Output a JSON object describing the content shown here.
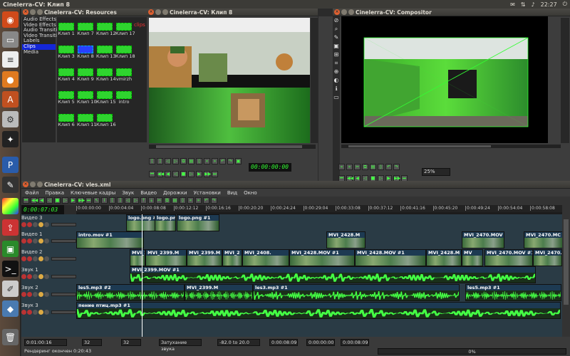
{
  "topbar": {
    "title": "Cinelerra-CV: Клип 8",
    "time": "22:27"
  },
  "resources": {
    "title": "Cinelerra-CV: Resources",
    "tree": [
      "Audio Effects",
      "Video Effects",
      "Audio Transiti",
      "Video Transiti",
      "Labels",
      "Clips",
      "Media"
    ],
    "selected_index": 5,
    "clips": [
      {
        "label": "Клип 1",
        "col": 0,
        "row": 0
      },
      {
        "label": "Клип 7",
        "col": 1,
        "row": 0
      },
      {
        "label": "Клип 12",
        "col": 2,
        "row": 0
      },
      {
        "label": "Клип 17",
        "col": 3,
        "row": 0
      },
      {
        "label": "Клип 3",
        "col": 0,
        "row": 1
      },
      {
        "label": "Клип 8",
        "col": 1,
        "row": 1
      },
      {
        "label": "Клип 13",
        "col": 2,
        "row": 1
      },
      {
        "label": "Клип 18",
        "col": 3,
        "row": 1
      },
      {
        "label": "Клип 4",
        "col": 0,
        "row": 2
      },
      {
        "label": "Клип 9",
        "col": 1,
        "row": 2
      },
      {
        "label": "Клип 14",
        "col": 2,
        "row": 2
      },
      {
        "label": "vmirzh",
        "col": 3,
        "row": 2
      },
      {
        "label": "Клип 5",
        "col": 0,
        "row": 3
      },
      {
        "label": "Клип 10",
        "col": 1,
        "row": 3
      },
      {
        "label": "Клип 15",
        "col": 2,
        "row": 3
      },
      {
        "label": "intro",
        "col": 3,
        "row": 3
      },
      {
        "label": "Клип 6",
        "col": 0,
        "row": 4
      },
      {
        "label": "Клип 11",
        "col": 1,
        "row": 4
      },
      {
        "label": "Клип 16",
        "col": 2,
        "row": 4
      }
    ],
    "selected_clip": "Клип 8",
    "overlay": "clips"
  },
  "viewer": {
    "title": "Cinelerra-CV: Клип 8",
    "timecode": "00:00:00:00"
  },
  "compositor": {
    "title": "Cinelerra-CV: Compositor",
    "zoom": "25%"
  },
  "main": {
    "title": "Cinelerra-CV: vles.xml",
    "menu": [
      "Файл",
      "Правка",
      "Ключевые кадры",
      "Звук",
      "Видео",
      "Дорожки",
      "Установки",
      "Вид",
      "Окно"
    ],
    "position": "0:00:07:03",
    "ruler": [
      "0:00:00:00",
      "0:00:04:04",
      "0:00:08:08",
      "0:00:12:12",
      "0:00:16:16",
      "0:00:20:20",
      "0:00:24:24",
      "0:00:29:04",
      "0:00:33:08",
      "0:00:37:12",
      "0:00:41:16",
      "0:00:45:20",
      "0:00:49:24",
      "0:00:54:04",
      "0:00:58:08"
    ],
    "tracks": [
      {
        "name": "Видео 3",
        "kind": "v"
      },
      {
        "name": "Видео 1",
        "kind": "v"
      },
      {
        "name": "Видео 2",
        "kind": "v"
      },
      {
        "name": "Звук 1",
        "kind": "a"
      },
      {
        "name": "Звук 2",
        "kind": "a"
      },
      {
        "name": "Звук 3",
        "kind": "a"
      }
    ],
    "edits": {
      "v3": [
        "logo.png #1",
        "logo.png #1",
        "logo.png #1"
      ],
      "v1": [
        "intro.mov #1",
        "MVI_2428.M",
        "MVI_2470.MOV",
        "MVI_2470.MC"
      ],
      "v2": [
        "MVI_23",
        "MVI_2399.M",
        "MVI_2399.M",
        "MVI_2",
        "MVI_2408.",
        "MVI_2428.MOV #1",
        "MVI_2428.MOV #1",
        "MVI_2428.M",
        "MV",
        "MVI_2470.MOV #1",
        "MVI_2470.MOV #1"
      ],
      "a1": [
        "MVI_2399.MOV #1"
      ],
      "a2": [
        "les5.mp3 #2",
        "MVI_2399.M",
        "les3.mp3 #1",
        "les5.mp3 #1"
      ],
      "a3": [
        "пение птиц.mp3 #1"
      ]
    },
    "status": {
      "in_time": "0:01:00:16",
      "val1": "32",
      "val2": "32",
      "mode": "Затухание звука",
      "range": "-82.0 to 20.0",
      "t1": "0:00:08:09",
      "t2": "0:00:00:00",
      "t3": "0:00:08:09",
      "render": "Рендеринг окончен 0:20:43",
      "percent": "0%"
    }
  },
  "colors": {
    "clip": "#2fd42f",
    "selected": "#1427d8",
    "track_bg": "#2a3b45"
  }
}
